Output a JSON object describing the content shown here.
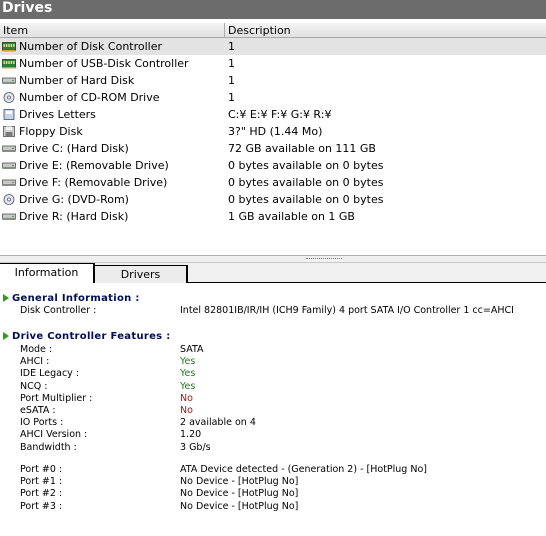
{
  "window": {
    "title": "Drives"
  },
  "columns": {
    "item": "Item",
    "description": "Description"
  },
  "rows": [
    {
      "icon": "disk-controller-icon",
      "name": "Number of Disk Controller",
      "desc": "1"
    },
    {
      "icon": "usb-controller-icon",
      "name": "Number of USB-Disk Controller",
      "desc": "1"
    },
    {
      "icon": "hard-disk-icon",
      "name": "Number of Hard Disk",
      "desc": "1"
    },
    {
      "icon": "cdrom-icon",
      "name": "Number of CD-ROM Drive",
      "desc": "1"
    },
    {
      "icon": "drive-letters-icon",
      "name": "Drives Letters",
      "desc": "C:¥ E:¥ F:¥ G:¥ R:¥"
    },
    {
      "icon": "floppy-icon",
      "name": "Floppy Disk",
      "desc": "3?\" HD (1.44 Mo)"
    },
    {
      "icon": "hard-disk-icon",
      "name": "Drive C: (Hard Disk)",
      "desc": "72 GB available on 111 GB"
    },
    {
      "icon": "removable-drive-icon",
      "name": "Drive E: (Removable Drive)",
      "desc": "0 bytes available on 0 bytes"
    },
    {
      "icon": "removable-drive-icon",
      "name": "Drive F: (Removable Drive)",
      "desc": "0 bytes available on 0 bytes"
    },
    {
      "icon": "dvd-drive-icon",
      "name": "Drive G: (DVD-Rom)",
      "desc": "0 bytes available on 0 bytes"
    },
    {
      "icon": "hard-disk-icon",
      "name": "Drive R: (Hard Disk)",
      "desc": "1 GB available on 1 GB"
    }
  ],
  "tabs": {
    "information": "Information",
    "drivers": "Drivers"
  },
  "general": {
    "heading": "General Information :",
    "controller_label": "Disk Controller :",
    "controller_value": "Intel 82801IB/IR/IH (ICH9 Family) 4 port SATA I/O Controller 1 cc=AHCI"
  },
  "features": {
    "heading": "Drive Controller Features :",
    "items": [
      {
        "label": "Mode :",
        "value": "SATA",
        "color": "#000000"
      },
      {
        "label": "AHCI :",
        "value": "Yes",
        "color": "#1f7a1f"
      },
      {
        "label": "IDE Legacy :",
        "value": "Yes",
        "color": "#1f7a1f"
      },
      {
        "label": "NCQ :",
        "value": "Yes",
        "color": "#1f7a1f"
      },
      {
        "label": "Port Multiplier :",
        "value": "No",
        "color": "#a01818"
      },
      {
        "label": "eSATA :",
        "value": "No",
        "color": "#a01818"
      },
      {
        "label": "IO Ports :",
        "value": "2 available on 4",
        "color": "#000000"
      },
      {
        "label": "AHCI Version :",
        "value": "1.20",
        "color": "#000000"
      },
      {
        "label": "Bandwidth :",
        "value": "3  Gb/s",
        "color": "#000000"
      }
    ],
    "ports": [
      {
        "label": "Port #0 :",
        "value": "ATA Device detected  -  (Generation 2)  -  [HotPlug No]"
      },
      {
        "label": "Port #1 :",
        "value": "No Device  -  [HotPlug No]"
      },
      {
        "label": "Port #2 :",
        "value": "No Device  -  [HotPlug No]"
      },
      {
        "label": "Port #3 :",
        "value": "No Device  -  [HotPlug No]"
      }
    ]
  }
}
